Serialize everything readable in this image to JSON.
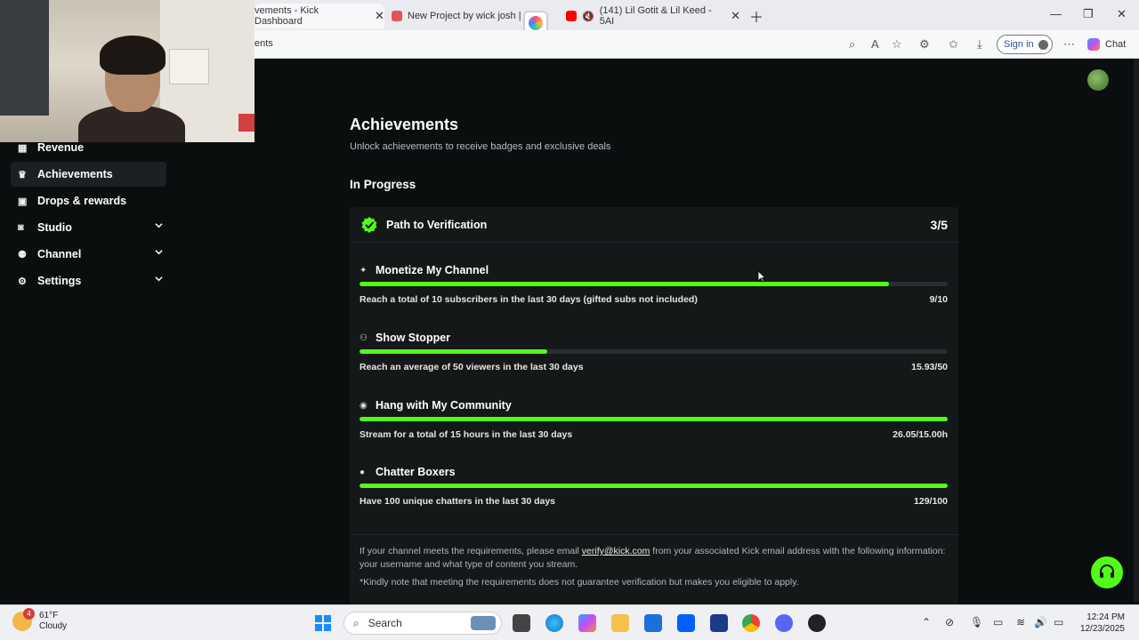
{
  "browser": {
    "tabs": [
      {
        "label": "vements - Kick Dashboard",
        "active": true
      },
      {
        "label": "New Project by wick josh | Ba",
        "active": false
      },
      {
        "label": "(141) Lil Gotit & Lil Keed - 5AI",
        "active": false
      }
    ],
    "address": "ents",
    "signin_label": "Sign in",
    "chat_label": "Chat"
  },
  "sidebar": {
    "items": [
      {
        "label": "Revenue",
        "icon": "revenue-icon"
      },
      {
        "label": "Achievements",
        "icon": "trophy-icon",
        "active": true
      },
      {
        "label": "Drops & rewards",
        "icon": "gift-icon"
      },
      {
        "label": "Studio",
        "icon": "studio-icon",
        "expandable": true
      },
      {
        "label": "Channel",
        "icon": "users-icon",
        "expandable": true
      },
      {
        "label": "Settings",
        "icon": "gear-icon",
        "expandable": true
      }
    ]
  },
  "main": {
    "title": "Achievements",
    "subtitle": "Unlock achievements to receive badges and exclusive deals",
    "section": "In Progress",
    "card": {
      "title": "Path to Verification",
      "count": "3/5",
      "achievements": [
        {
          "name": "Monetize My Channel",
          "icon": "sparkle-icon",
          "desc": "Reach a total of 10 subscribers in the last 30 days (gifted subs not included)",
          "progress": "9/10",
          "fraction": 0.9
        },
        {
          "name": "Show Stopper",
          "icon": "viewers-icon",
          "desc": "Reach an average of 50 viewers in the last 30 days",
          "progress": "15.93/50",
          "fraction": 0.3186
        },
        {
          "name": "Hang with My Community",
          "icon": "broadcast-icon",
          "desc": "Stream for a total of 15 hours in the last 30 days",
          "progress": "26.05/15.00h",
          "fraction": 1.0
        },
        {
          "name": "Chatter Boxers",
          "icon": "chat-bubble-icon",
          "desc": "Have 100 unique chatters in the last 30 days",
          "progress": "129/100",
          "fraction": 1.0
        }
      ],
      "note_pre": "If your channel meets the requirements, please email ",
      "note_email": "verify@kick.com",
      "note_post": " from your associated Kick email address with the following information: your username and what type of content you stream.",
      "note2": "*Kindly note that meeting the requirements does not guarantee verification but makes you eligible to apply."
    }
  },
  "colors": {
    "accent": "#53fc18",
    "background": "#0b0e0f",
    "card": "#151819"
  },
  "taskbar": {
    "weather_temp": "61°F",
    "weather_desc": "Cloudy",
    "weather_badge": "4",
    "search_label": "Search",
    "time": "12:24 PM",
    "date": "12/23/2025"
  }
}
